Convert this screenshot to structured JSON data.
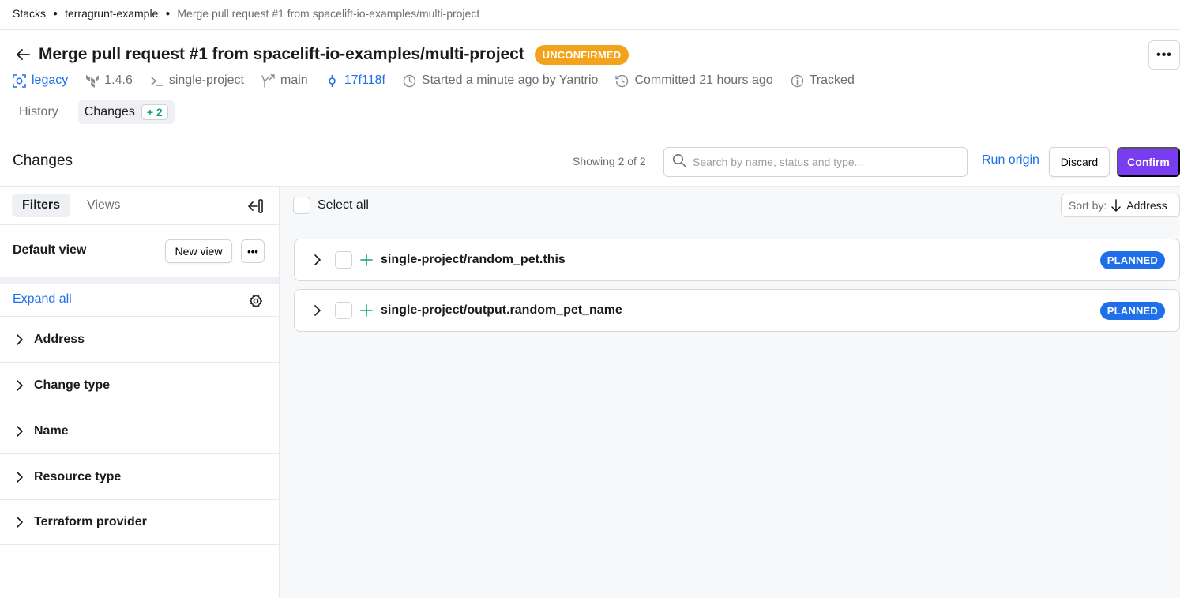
{
  "breadcrumb": {
    "items": [
      "Stacks",
      "terragrunt-example"
    ],
    "current": "Merge pull request #1 from spacelift-io-examples/multi-project"
  },
  "header": {
    "title": "Merge pull request #1 from spacelift-io-examples/multi-project",
    "status_badge": "UNCONFIRMED",
    "more_label": "•••"
  },
  "meta": {
    "space": "legacy",
    "version": "1.4.6",
    "project_root": "single-project",
    "branch": "main",
    "commit": "17f118f",
    "started": "Started a minute ago by Yantrio",
    "committed": "Committed 21 hours ago",
    "tracked": "Tracked"
  },
  "tabs": {
    "history": "History",
    "changes": "Changes",
    "changes_count": "+ 2"
  },
  "changes": {
    "heading": "Changes",
    "showing": "Showing 2 of 2",
    "search_placeholder": "Search by name, status and type...",
    "run_origin": "Run origin",
    "discard": "Discard",
    "confirm": "Confirm"
  },
  "sidebar": {
    "tabs": [
      "Filters",
      "Views"
    ],
    "default_view": "Default view",
    "new_view": "New view",
    "more_label": "•••",
    "expand_all": "Expand all",
    "filters": [
      "Address",
      "Change type",
      "Name",
      "Resource type",
      "Terraform provider"
    ]
  },
  "list": {
    "select_all": "Select all",
    "sort_label": "Sort by:",
    "sort_value": "Address",
    "resources": [
      {
        "name": "single-project/random_pet.this",
        "status": "PLANNED"
      },
      {
        "name": "single-project/output.random_pet_name",
        "status": "PLANNED"
      }
    ]
  },
  "colors": {
    "accent_purple": "#7a3cf0",
    "link_blue": "#1f6feb",
    "unconfirmed_orange": "#f2a31b",
    "planned_blue": "#1f6feb",
    "add_green": "#14a36f"
  },
  "icons": [
    "back-arrow-icon",
    "space-icon",
    "terraform-icon",
    "terminal-icon",
    "branch-icon",
    "commit-icon",
    "clock-icon",
    "history-icon",
    "info-icon",
    "search-icon",
    "collapse-sidebar-icon",
    "gear-icon",
    "chevron-right-icon",
    "plus-icon",
    "sort-arrow-down-icon"
  ]
}
